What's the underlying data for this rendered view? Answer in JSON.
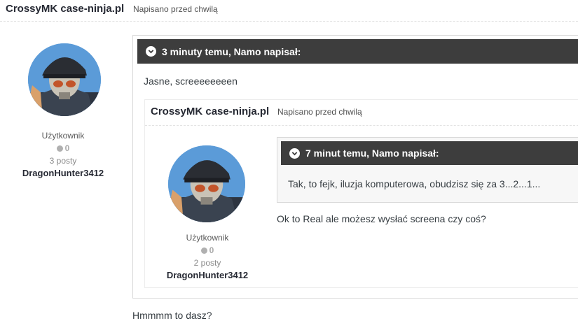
{
  "post": {
    "author": "CrossyMK case-ninja.pl",
    "date": "Napisano przed chwilą",
    "profile": {
      "role": "Użytkownik",
      "reputation": "0",
      "posts": "3 posty",
      "username": "DragonHunter3412"
    },
    "quote": {
      "header": "3 minuty temu, Namo napisał:",
      "text": "Jasne, screeeeeeeen",
      "nested_post": {
        "author": "CrossyMK case-ninja.pl",
        "date": "Napisano przed chwilą",
        "profile": {
          "role": "Użytkownik",
          "reputation": "0",
          "posts": "2 posty",
          "username": "DragonHunter3412"
        },
        "quote": {
          "header": "7 minut temu, Namo napisał:",
          "text": "Tak, to fejk, iluzja komputerowa, obudzisz się za 3...2...1..."
        },
        "text": "Ok to Real ale możesz wysłać screena czy coś?"
      }
    },
    "reply_text": "Hmmmm to dasz?"
  },
  "icons": {
    "quote_toggle": "chevron-down-icon",
    "reputation": "reputation-dot-icon",
    "avatar": "soldier-skull-mask-avatar"
  }
}
